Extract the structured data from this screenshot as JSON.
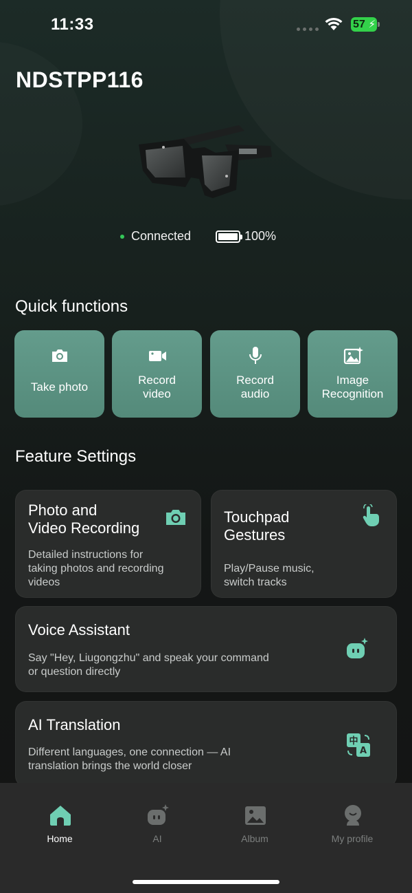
{
  "status_bar": {
    "time": "11:33",
    "battery": "57"
  },
  "device": {
    "name": "NDSTPP116",
    "connection_status": "Connected",
    "battery_level": "100%"
  },
  "quick_functions": {
    "title": "Quick functions",
    "items": [
      {
        "label": "Take photo",
        "icon": "camera-icon"
      },
      {
        "label": "Record\nvideo",
        "icon": "video-camera-icon"
      },
      {
        "label": "Record\naudio",
        "icon": "microphone-icon"
      },
      {
        "label": "Image\nRecognition",
        "icon": "image-sparkle-icon"
      }
    ]
  },
  "feature_settings": {
    "title": "Feature Settings",
    "cards": [
      {
        "title": "Photo and\nVideo Recording",
        "description": "Detailed instructions for\ntaking photos and recording\nvideos",
        "icon": "camera-icon"
      },
      {
        "title": "Touchpad\nGestures",
        "description": "Play/Pause music,\nswitch tracks",
        "icon": "hand-tap-icon"
      },
      {
        "title": "Voice Assistant",
        "description": "Say \"Hey, Liugongzhu\" and speak your command\nor question directly",
        "icon": "ai-bot-icon"
      },
      {
        "title": "AI Translation",
        "description": "Different languages, one connection — AI\ntranslation brings the world closer",
        "icon": "translate-icon"
      }
    ]
  },
  "tab_bar": {
    "tabs": [
      {
        "label": "Home",
        "icon": "home-icon",
        "active": true
      },
      {
        "label": "AI",
        "icon": "ai-bot-icon",
        "active": false
      },
      {
        "label": "Album",
        "icon": "album-icon",
        "active": false
      },
      {
        "label": "My profile",
        "icon": "profile-icon",
        "active": false
      }
    ]
  },
  "colors": {
    "accent": "#5a917f",
    "icon_green": "#6fcfb3",
    "card_bg": "#2a2c2b",
    "connected": "#34c759"
  }
}
